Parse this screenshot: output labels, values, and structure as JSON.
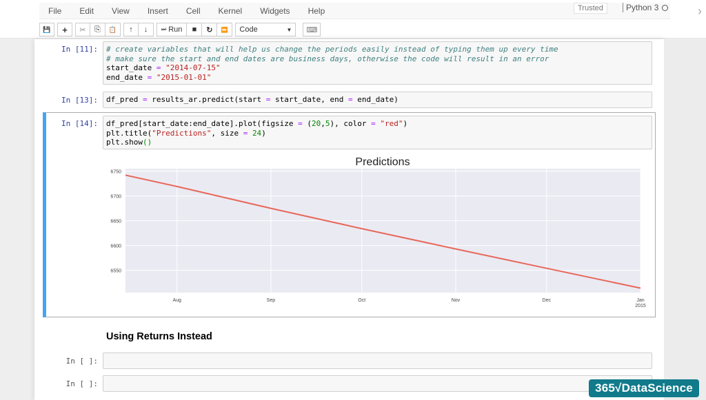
{
  "menu": {
    "items": [
      "File",
      "Edit",
      "View",
      "Insert",
      "Cell",
      "Kernel",
      "Widgets",
      "Help"
    ],
    "trusted_label": "Trusted",
    "kernel_label": "Python 3"
  },
  "toolbar": {
    "save_icon": "💾",
    "add_icon": "+",
    "cut_icon": "✂",
    "copy_icon": "⎘",
    "paste_icon": "📋",
    "move_up_icon": "↑",
    "move_down_icon": "↓",
    "run_label": "Run",
    "run_icon": "⏭",
    "stop_icon": "■",
    "restart_icon": "↻",
    "fast_forward_icon": "⏩",
    "cell_type": "Code",
    "keyboard_icon": "⌨"
  },
  "cells": {
    "c11": {
      "prompt": "In [11]:",
      "line1": "# create variables that will help us change the periods easily instead of typing them up every time",
      "line2": "# make sure the start and end dates are business days, otherwise the code will result in an error",
      "line3_var": "start_date",
      "line3_op": " = ",
      "line3_val": "\"2014-07-15\"",
      "line4_var": "end_date",
      "line4_op": " = ",
      "line4_val": "\"2015-01-01\""
    },
    "c13": {
      "prompt": "In [13]:",
      "code_a": "df_pred ",
      "op1": "=",
      "code_b": " results_ar.predict(start ",
      "op2": "=",
      "code_c": " start_date, end ",
      "op3": "=",
      "code_d": " end_date)"
    },
    "c14": {
      "prompt": "In [14]:",
      "l1a": "df_pred[start_date:end_date].plot(figsize ",
      "l1op": "=",
      "l1b": " (",
      "l1n1": "20",
      "l1c": ",",
      "l1n2": "5",
      "l1d": "), color ",
      "l1op2": "=",
      "l1e": " ",
      "l1s": "\"red\"",
      "l1f": ")",
      "l2a": "plt.title(",
      "l2s": "\"Predictions\"",
      "l2b": ", size ",
      "l2op": "=",
      "l2c": " ",
      "l2n": "24",
      "l2d": ")",
      "l3a": "plt.show",
      "l3p": "()"
    },
    "heading": "Using Returns Instead",
    "empty_prompt_1": "In [ ]:",
    "empty_prompt_2": "In [ ]:"
  },
  "logo": "365√DataScience",
  "chart_data": {
    "type": "line",
    "title": "Predictions",
    "xlabel": "",
    "ylabel": "",
    "x_range": [
      "2014-07-15",
      "2015-01-01"
    ],
    "x_ticks": [
      {
        "date": "2014-08-01",
        "label": "Aug"
      },
      {
        "date": "2014-09-01",
        "label": "Sep"
      },
      {
        "date": "2014-10-01",
        "label": "Oct"
      },
      {
        "date": "2014-11-01",
        "label": "Nov"
      },
      {
        "date": "2014-12-01",
        "label": "Dec"
      },
      {
        "date": "2015-01-01",
        "label": "Jan\n2015"
      }
    ],
    "y_ticks": [
      6550,
      6600,
      6650,
      6700,
      6750
    ],
    "ylim": [
      6505,
      6755
    ],
    "grid": true,
    "line_color": "#e8675a",
    "background": "#eaeaf2",
    "series": [
      {
        "name": "df_pred",
        "points": [
          {
            "x": "2014-07-15",
            "y": 6742
          },
          {
            "x": "2014-08-01",
            "y": 6719
          },
          {
            "x": "2014-09-01",
            "y": 6675
          },
          {
            "x": "2014-10-01",
            "y": 6634
          },
          {
            "x": "2014-11-01",
            "y": 6593
          },
          {
            "x": "2014-12-01",
            "y": 6554
          },
          {
            "x": "2015-01-01",
            "y": 6514
          }
        ]
      }
    ]
  }
}
